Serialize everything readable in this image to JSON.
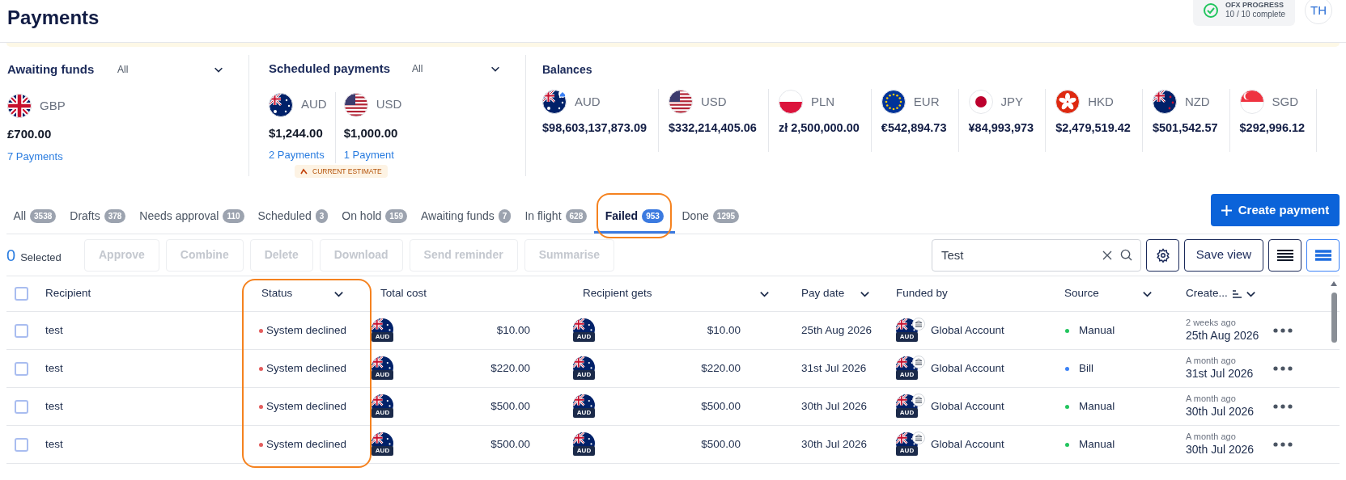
{
  "header": {
    "title": "Payments",
    "progress": {
      "label": "OFX PROGRESS",
      "text": "10 / 10 complete"
    },
    "avatar": "TH"
  },
  "awaiting_funds": {
    "title": "Awaiting funds",
    "filter": "All",
    "items": [
      {
        "currency": "GBP",
        "amount": "£700.00",
        "link": "7 Payments"
      }
    ]
  },
  "scheduled_payments": {
    "title": "Scheduled payments",
    "filter": "All",
    "items": [
      {
        "currency": "AUD",
        "amount": "$1,244.00",
        "link": "2 Payments"
      },
      {
        "currency": "USD",
        "amount": "$1,000.00",
        "link": "1 Payment"
      }
    ],
    "badge": "CURRENT ESTIMATE"
  },
  "balances": {
    "title": "Balances",
    "items": [
      {
        "currency": "AUD",
        "amount": "$98,603,137,873.09"
      },
      {
        "currency": "USD",
        "amount": "$332,214,405.06"
      },
      {
        "currency": "PLN",
        "amount": "zł 2,500,000.00"
      },
      {
        "currency": "EUR",
        "amount": "€542,894.73"
      },
      {
        "currency": "JPY",
        "amount": "¥84,993,973"
      },
      {
        "currency": "HKD",
        "amount": "$2,479,519.42"
      },
      {
        "currency": "NZD",
        "amount": "$501,542.57"
      },
      {
        "currency": "SGD",
        "amount": "$292,996.12"
      }
    ]
  },
  "tabs": [
    {
      "label": "All",
      "count": "3538",
      "selected": false
    },
    {
      "label": "Drafts",
      "count": "378",
      "selected": false
    },
    {
      "label": "Needs approval",
      "count": "110",
      "selected": false
    },
    {
      "label": "Scheduled",
      "count": "3",
      "selected": false
    },
    {
      "label": "On hold",
      "count": "159",
      "selected": false
    },
    {
      "label": "Awaiting funds",
      "count": "7",
      "selected": false
    },
    {
      "label": "In flight",
      "count": "628",
      "selected": false
    },
    {
      "label": "Failed",
      "count": "953",
      "selected": true
    },
    {
      "label": "Done",
      "count": "1295",
      "selected": false
    }
  ],
  "create_button": "Create payment",
  "selection": {
    "count": "0",
    "label": "Selected"
  },
  "actions": [
    {
      "label": "Approve",
      "disabled": true
    },
    {
      "label": "Combine",
      "disabled": true
    },
    {
      "label": "Delete",
      "disabled": true
    },
    {
      "label": "Download",
      "disabled": true
    },
    {
      "label": "Send reminder",
      "disabled": true
    },
    {
      "label": "Summarise",
      "disabled": true
    }
  ],
  "search": {
    "value": "Test"
  },
  "save_view": "Save view",
  "view_toggles": [
    {
      "selected": false
    },
    {
      "selected": true
    }
  ],
  "table": {
    "select_all": {
      "checked": false
    },
    "columns": [
      {
        "label": "Recipient",
        "dropdown": false
      },
      {
        "label": "Status",
        "dropdown": true
      },
      {
        "label": "Total cost",
        "dropdown": false
      },
      {
        "label": "Recipient gets",
        "dropdown": true
      },
      {
        "label": "Pay date",
        "dropdown": true
      },
      {
        "label": "Funded by",
        "dropdown": false
      },
      {
        "label": "Source",
        "dropdown": true
      },
      {
        "label": "Create...",
        "dropdown": true
      }
    ],
    "rows": [
      {
        "checked": false,
        "recipient": "test",
        "status": {
          "text": "System declined",
          "color": "#e35d5d"
        },
        "total_cost": {
          "currency": "AUD",
          "amount": "$10.00"
        },
        "recipient_gets": {
          "currency": "AUD",
          "amount": "$10.00"
        },
        "pay_date": "25th Aug 2026",
        "funded_by": {
          "currency": "AUD",
          "name": "Global Account"
        },
        "source": {
          "text": "Manual",
          "color": "#22c55e"
        },
        "created_ago": "2 weeks ago",
        "created_date": "25th Aug 2026"
      },
      {
        "checked": false,
        "recipient": "test",
        "status": {
          "text": "System declined",
          "color": "#e35d5d"
        },
        "total_cost": {
          "currency": "AUD",
          "amount": "$220.00"
        },
        "recipient_gets": {
          "currency": "AUD",
          "amount": "$220.00"
        },
        "pay_date": "31st Jul 2026",
        "funded_by": {
          "currency": "AUD",
          "name": "Global Account"
        },
        "source": {
          "text": "Bill",
          "color": "#3b82f6"
        },
        "created_ago": "A month ago",
        "created_date": "31st Jul 2026"
      },
      {
        "checked": false,
        "recipient": "test",
        "status": {
          "text": "System declined",
          "color": "#e35d5d"
        },
        "total_cost": {
          "currency": "AUD",
          "amount": "$500.00"
        },
        "recipient_gets": {
          "currency": "AUD",
          "amount": "$500.00"
        },
        "pay_date": "30th Jul 2026",
        "funded_by": {
          "currency": "AUD",
          "name": "Global Account"
        },
        "source": {
          "text": "Manual",
          "color": "#22c55e"
        },
        "created_ago": "A month ago",
        "created_date": "30th Jul 2026"
      },
      {
        "checked": false,
        "recipient": "test",
        "status": {
          "text": "System declined",
          "color": "#e35d5d"
        },
        "total_cost": {
          "currency": "AUD",
          "amount": "$500.00"
        },
        "recipient_gets": {
          "currency": "AUD",
          "amount": "$500.00"
        },
        "pay_date": "30th Jul 2026",
        "funded_by": {
          "currency": "AUD",
          "name": "Global Account"
        },
        "source": {
          "text": "Manual",
          "color": "#22c55e"
        },
        "created_ago": "A month ago",
        "created_date": "30th Jul 2026"
      }
    ]
  }
}
